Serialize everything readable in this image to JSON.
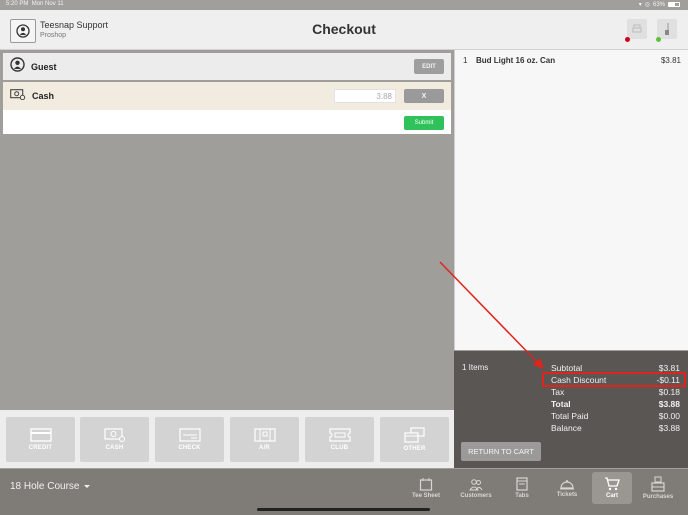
{
  "status_bar": {
    "time": "5:20 PM",
    "date": "Mon Nov 11",
    "battery": "63%"
  },
  "header": {
    "user_name": "Teesnap Support",
    "user_role": "Proshop",
    "title": "Checkout",
    "printer_status_color": "#d0021b",
    "drawer_status_color": "#5cc23a"
  },
  "customer": {
    "label": "Guest",
    "edit_label": "EDIT"
  },
  "payment": {
    "method_label": "Cash",
    "amount_value": "3.88",
    "remove_label": "X",
    "submit_label": "Submit"
  },
  "payment_methods": [
    {
      "label": "CREDIT",
      "icon": "credit-card-icon"
    },
    {
      "label": "CASH",
      "icon": "cash-icon"
    },
    {
      "label": "CHECK",
      "icon": "check-icon"
    },
    {
      "label": "A/R",
      "icon": "ar-book-icon"
    },
    {
      "label": "CLUB",
      "icon": "club-ticket-icon"
    },
    {
      "label": "OTHER",
      "icon": "other-cards-icon"
    }
  ],
  "cart": {
    "items": [
      {
        "qty": "1",
        "name": "Bud Light 16 oz. Can",
        "price": "$3.81"
      }
    ]
  },
  "summary": {
    "items_count": "1 Items",
    "rows": [
      {
        "label": "Subtotal",
        "value": "$3.81"
      },
      {
        "label": "Cash Discount",
        "value": "-$0.11"
      },
      {
        "label": "Tax",
        "value": "$0.18"
      },
      {
        "label": "Total",
        "value": "$3.88"
      },
      {
        "label": "Total Paid",
        "value": "$0.00"
      },
      {
        "label": "Balance",
        "value": "$3.88"
      }
    ],
    "return_label": "RETURN TO CART",
    "highlight_color": "#e0241b"
  },
  "tabbar": {
    "course": "18 Hole Course",
    "tabs": [
      {
        "label": "Tee Sheet",
        "icon": "calendar-icon"
      },
      {
        "label": "Customers",
        "icon": "customers-icon"
      },
      {
        "label": "Tabs",
        "icon": "tabs-icon"
      },
      {
        "label": "Tickets",
        "icon": "bell-icon"
      },
      {
        "label": "Cart",
        "icon": "cart-icon",
        "active": true
      },
      {
        "label": "Purchases",
        "icon": "register-icon"
      }
    ]
  }
}
